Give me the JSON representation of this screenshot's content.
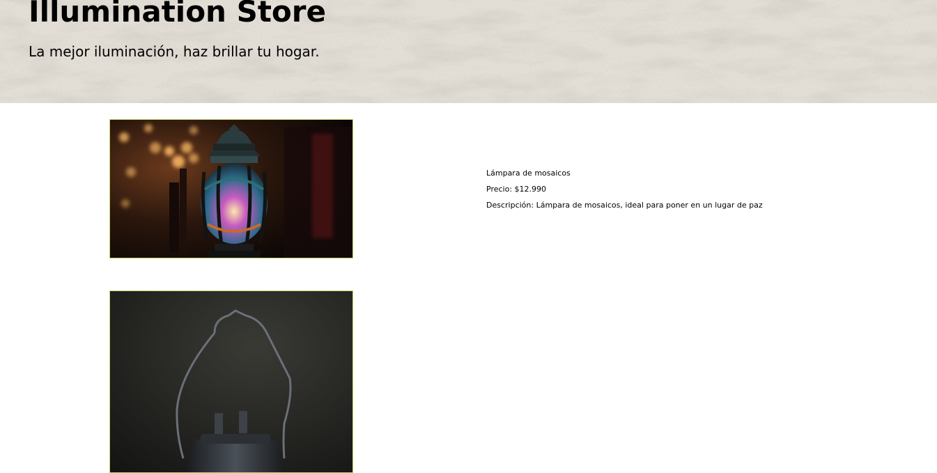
{
  "header": {
    "title": "Illumination Store",
    "tagline": "La mejor iluminación, haz brillar tu hogar."
  },
  "products": [
    {
      "image_alt": "lantern-mosaic-image",
      "name": "Lámpara de mosaicos",
      "price": "Precio: $12.990",
      "description": "Descripción: Lámpara de mosaicos, ideal para poner en un lugar de paz"
    },
    {
      "image_alt": "old-lantern-image",
      "name": "",
      "price": "",
      "description": ""
    }
  ],
  "colors": {
    "header_bg": "#e4dfd6",
    "image_border": "#c9d46a",
    "text": "#000000"
  }
}
